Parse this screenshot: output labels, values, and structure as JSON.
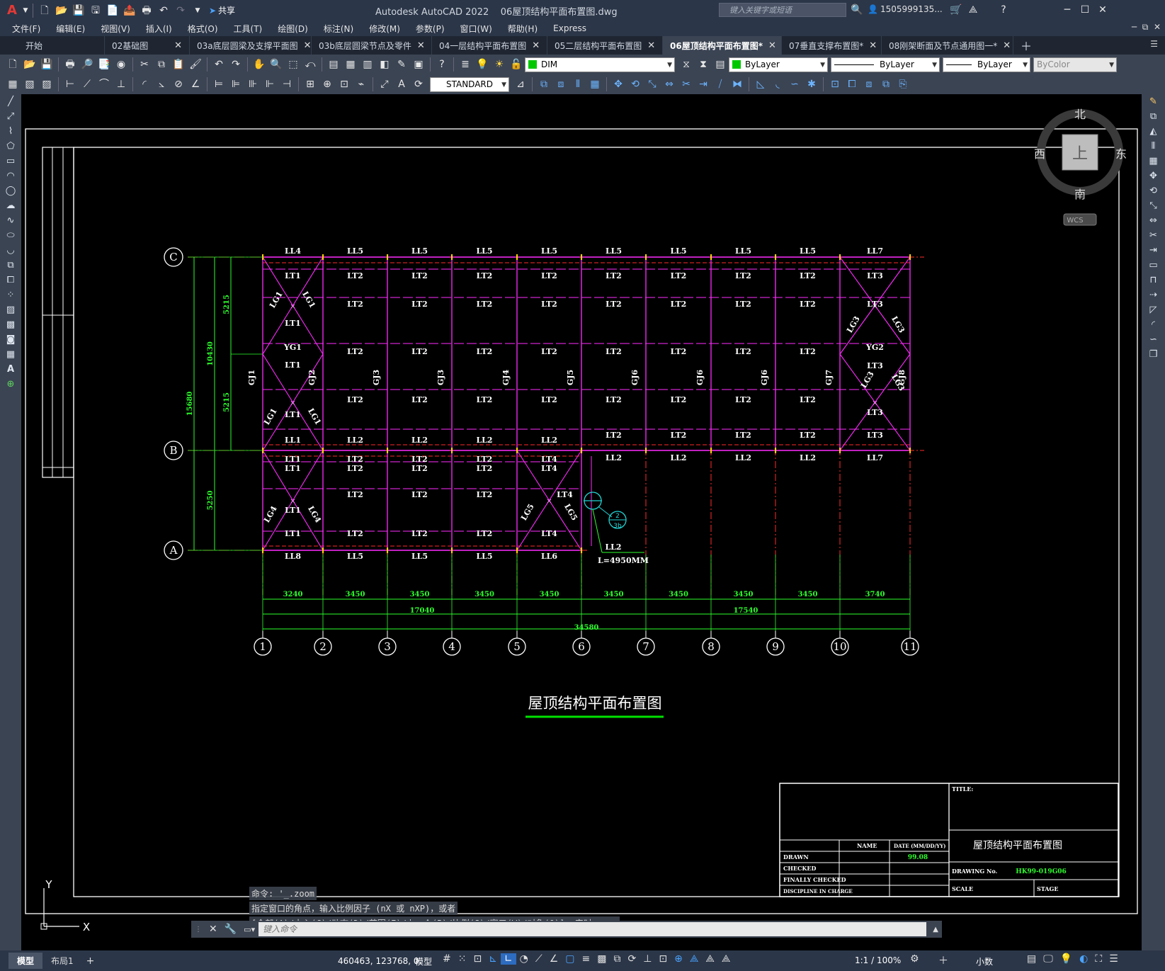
{
  "app": {
    "title": "Autodesk AutoCAD 2022    06屋顶结构平面布置图.dwg",
    "share_label": "共享",
    "search_placeholder": "键入关键字或短语",
    "user": "1505999135...",
    "logo": "A"
  },
  "menus": [
    "文件(F)",
    "编辑(E)",
    "视图(V)",
    "插入(I)",
    "格式(O)",
    "工具(T)",
    "绘图(D)",
    "标注(N)",
    "修改(M)",
    "参数(P)",
    "窗口(W)",
    "帮助(H)",
    "Express"
  ],
  "tabs": [
    {
      "label": "开始",
      "close": false,
      "active": false
    },
    {
      "label": "02基础图",
      "close": true,
      "active": false
    },
    {
      "label": "03a底层圆梁及支撑平面图",
      "close": true,
      "active": false
    },
    {
      "label": "03b底层圆梁节点及零件",
      "close": true,
      "active": false
    },
    {
      "label": "04一层结构平面布置图",
      "close": true,
      "active": false
    },
    {
      "label": "05二层结构平面布置图",
      "close": true,
      "active": false
    },
    {
      "label": "06屋顶结构平面布置图*",
      "close": true,
      "active": true
    },
    {
      "label": "07垂直支撑布置图*",
      "close": true,
      "active": false
    },
    {
      "label": "08刚架断面及节点通用图一*",
      "close": true,
      "active": false
    }
  ],
  "toolbar": {
    "layer": "DIM",
    "color": "ByLayer",
    "linetype": "ByLayer",
    "lineweight": "ByLayer",
    "plotstyle": "ByColor",
    "textstyle": "STANDARD"
  },
  "viewcube": {
    "north": "北",
    "south": "南",
    "east": "东",
    "west": "西",
    "top": "上",
    "wcs": "WCS"
  },
  "drawing": {
    "title": "屋顶结构平面布置图",
    "axis_rows": [
      "C",
      "B",
      "A"
    ],
    "axis_cols": [
      "1",
      "2",
      "3",
      "4",
      "5",
      "6",
      "7",
      "8",
      "9",
      "10",
      "11"
    ],
    "bay_dims": [
      "3240",
      "3450",
      "3450",
      "3450",
      "3450",
      "3450",
      "3450",
      "3450",
      "3450",
      "3740"
    ],
    "half_dims": [
      "17040",
      "17540"
    ],
    "total_dim": "34580",
    "left_dims": {
      "total": "15680",
      "c_b": "10430",
      "sub1": "5215",
      "sub2": "5215",
      "b_a": "5250"
    },
    "top_beams": [
      "LL4",
      "LL5",
      "LL5",
      "LL5",
      "LL5",
      "LL5",
      "LL5",
      "LL5",
      "LL5",
      "LL7"
    ],
    "mid_beams": [
      "LL1",
      "LL2",
      "LL2",
      "LL2",
      "LL2"
    ],
    "mid_beams2": [
      "LL2",
      "LL2",
      "LL2",
      "LL2",
      "LL7"
    ],
    "bot_beams": [
      "LL8",
      "LL5",
      "LL5",
      "LL5",
      "LL6"
    ],
    "frames": [
      "GJ1",
      "GJ2",
      "GJ3",
      "GJ3",
      "GJ4",
      "GJ5",
      "GJ6",
      "GJ6",
      "GJ6",
      "GJ7",
      "GJ8"
    ],
    "purlin_lt1": "LT1",
    "purlin_lt2": "LT2",
    "purlin_lt3": "LT3",
    "purlin_lt4": "LT4",
    "brace_yg1": "YG1",
    "brace_yg2": "YG2",
    "brace_lg1": "LG1",
    "brace_lg3": "LG3",
    "brace_lg4": "LG4",
    "brace_lg5": "LG5",
    "detail_num": "2",
    "detail_ref": "3b",
    "detail_beam": "LL2",
    "detail_length": "L=4950MM"
  },
  "titleblock": {
    "title_label": "TITLE:",
    "title_value": "屋顶结构平面布置图",
    "name_h": "NAME",
    "date_h": "DATE (MM/DD/YY)",
    "drawn": "DRAWN",
    "drawn_date": "99.08",
    "checked": "CHECKED",
    "finally_checked": "FINALLY CHECKED",
    "discipline": "DISCIPLINE IN CHARGE",
    "drawing_no_label": "DRAWING No.",
    "drawing_no": "HK99-019G06",
    "scale": "SCALE",
    "stage": "STAGE"
  },
  "ucs": {
    "x": "X",
    "y": "Y"
  },
  "command": {
    "history": [
      "命令: '_.zoom",
      "指定窗口的角点，输入比例因子 (nX 或 nXP)，或者",
      "[全部(A)/中心(C)/动态(D)/范围(E)/上一个(P)/比例(S)/窗口(W)/对象(O)] <实时>: _e"
    ],
    "placeholder": "键入命令"
  },
  "status": {
    "model_tab": "模型",
    "layout_tab": "布局1",
    "coords": "460463, 123768, 0",
    "model": "模型",
    "scale": "1:1 / 100%",
    "units": "小数"
  }
}
